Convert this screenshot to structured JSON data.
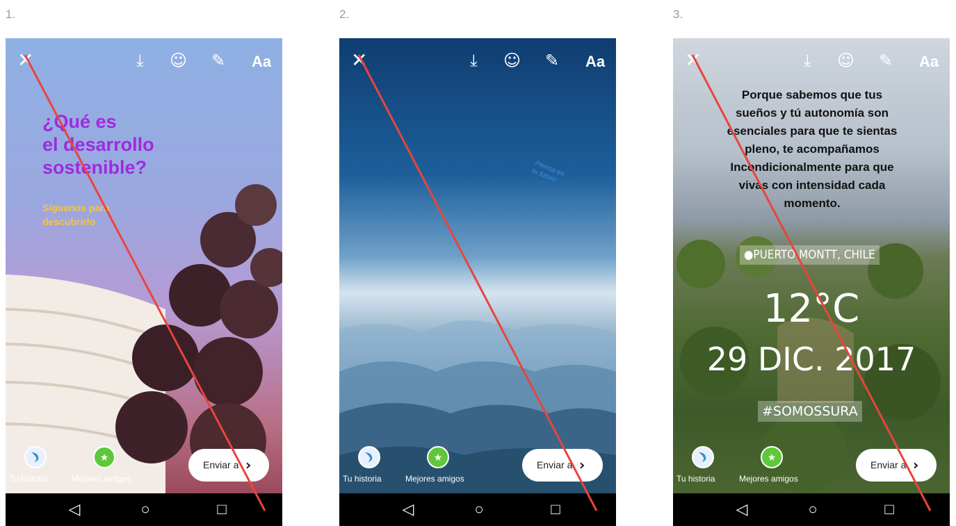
{
  "labels": [
    "1.",
    "2.",
    "3."
  ],
  "toolbar": {
    "text_tool": "Aa"
  },
  "share": {
    "your_story": "Tu historia",
    "close_friends": "Mejores amigos",
    "send": "Enviar a"
  },
  "story1": {
    "title_lines": [
      "¿Qué es",
      "el desarrollo",
      "sostenible?"
    ],
    "subtitle_lines": [
      "Síguenos para",
      "descubrirlo"
    ],
    "title_color": "#a02adf",
    "subtitle_color": "#f2c64a"
  },
  "story2": {
    "tilted_lines": [
      "Piensa en",
      "tu futuro"
    ],
    "tilted_color": "#3e8de0"
  },
  "story3": {
    "paragraph_lines": [
      "Porque sabemos que tus",
      "sueños y tú autonomía son",
      "esenciales para que te sientas",
      "pleno, te acompañamos",
      "Incondicionalmente para que",
      "vivas con intensidad cada",
      "momento."
    ],
    "location": "PUERTO MONTT, CHILE",
    "temperature": "12°C",
    "date": "29 DIC. 2017",
    "hashtag": "#SOMOSSURA"
  },
  "annotation_color": "#e8453c",
  "icons": [
    "close-icon",
    "download-icon",
    "sticker-icon",
    "draw-icon",
    "text-icon",
    "back-icon",
    "home-icon",
    "recent-apps-icon",
    "chevron-right-icon"
  ]
}
